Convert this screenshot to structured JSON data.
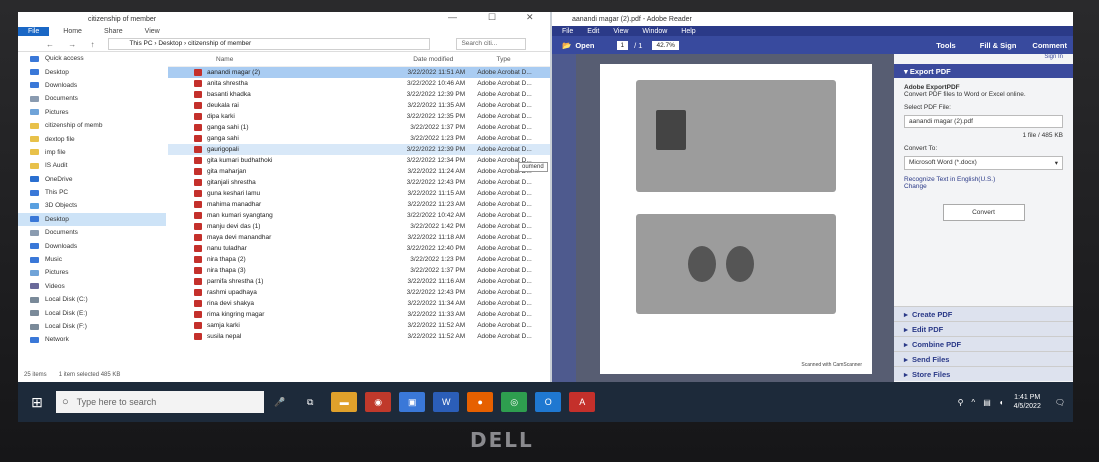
{
  "explorer": {
    "title": "citizenship of member",
    "ribbon": [
      "File",
      "Home",
      "Share",
      "View"
    ],
    "nav_glyphs": "← → ↑",
    "path": "This PC › Desktop › citizenship of member",
    "search_placeholder": "Search citi...",
    "nav_items": [
      {
        "label": "Quick access",
        "color": "#3a78d8"
      },
      {
        "label": "Desktop",
        "color": "#3a78d8"
      },
      {
        "label": "Downloads",
        "color": "#3a78d8"
      },
      {
        "label": "Documents",
        "color": "#8a9bb0"
      },
      {
        "label": "Pictures",
        "color": "#6fa3d8"
      },
      {
        "label": "citizenship of memb",
        "color": "#e8c14a"
      },
      {
        "label": "dextop file",
        "color": "#e8c14a"
      },
      {
        "label": "imp file",
        "color": "#e8c14a"
      },
      {
        "label": "IS Audit",
        "color": "#e8c14a"
      },
      {
        "label": "OneDrive",
        "color": "#2a6fd0"
      },
      {
        "label": "This PC",
        "color": "#3a78d8"
      },
      {
        "label": "3D Objects",
        "color": "#5aa0e0"
      },
      {
        "label": "Desktop",
        "color": "#3a78d8",
        "selected": true
      },
      {
        "label": "Documents",
        "color": "#8a9bb0"
      },
      {
        "label": "Downloads",
        "color": "#3a78d8"
      },
      {
        "label": "Music",
        "color": "#3a78d8"
      },
      {
        "label": "Pictures",
        "color": "#6fa3d8"
      },
      {
        "label": "Videos",
        "color": "#6a6a9a"
      },
      {
        "label": "Local Disk (C:)",
        "color": "#7a8a99"
      },
      {
        "label": "Local Disk (E:)",
        "color": "#7a8a99"
      },
      {
        "label": "Local Disk (F:)",
        "color": "#7a8a99"
      },
      {
        "label": "Network",
        "color": "#3a78d8"
      }
    ],
    "columns": {
      "name": "Name",
      "date": "Date modified",
      "type": "Type"
    },
    "files": [
      {
        "name": "aanandi magar (2)",
        "date": "3/22/2022 11:51 AM",
        "type": "Adobe Acrobat D...",
        "state": "selected"
      },
      {
        "name": "anita shrestha",
        "date": "3/22/2022 10:46 AM",
        "type": "Adobe Acrobat D..."
      },
      {
        "name": "basanti khadka",
        "date": "3/22/2022 12:39 PM",
        "type": "Adobe Acrobat D..."
      },
      {
        "name": "deukala rai",
        "date": "3/22/2022 11:35 AM",
        "type": "Adobe Acrobat D..."
      },
      {
        "name": "dipa karki",
        "date": "3/22/2022 12:35 PM",
        "type": "Adobe Acrobat D..."
      },
      {
        "name": "ganga sahi (1)",
        "date": "3/22/2022 1:37 PM",
        "type": "Adobe Acrobat D..."
      },
      {
        "name": "ganga sahi",
        "date": "3/22/2022 1:23 PM",
        "type": "Adobe Acrobat D..."
      },
      {
        "name": "gaurigopali",
        "date": "3/22/2022 12:39 PM",
        "type": "Adobe Acrobat D...",
        "state": "hover"
      },
      {
        "name": "gita kumari budhathoki",
        "date": "3/22/2022 12:34 PM",
        "type": "Adobe Acrobat D..."
      },
      {
        "name": "gita maharjan",
        "date": "3/22/2022 11:24 AM",
        "type": "Adobe Acrobat D..."
      },
      {
        "name": "gitanjali shrestha",
        "date": "3/22/2022 12:43 PM",
        "type": "Adobe Acrobat D..."
      },
      {
        "name": "guna keshari lamu",
        "date": "3/22/2022 11:15 AM",
        "type": "Adobe Acrobat D..."
      },
      {
        "name": "mahima manadhar",
        "date": "3/22/2022 11:23 AM",
        "type": "Adobe Acrobat D..."
      },
      {
        "name": "man kumari syangtang",
        "date": "3/22/2022 10:42 AM",
        "type": "Adobe Acrobat D..."
      },
      {
        "name": "manju devi das (1)",
        "date": "3/22/2022 1:42 PM",
        "type": "Adobe Acrobat D..."
      },
      {
        "name": "maya devi manandhar",
        "date": "3/22/2022 11:18 AM",
        "type": "Adobe Acrobat D..."
      },
      {
        "name": "nanu tuladhar",
        "date": "3/22/2022 12:40 PM",
        "type": "Adobe Acrobat D..."
      },
      {
        "name": "nira thapa (2)",
        "date": "3/22/2022 1:23 PM",
        "type": "Adobe Acrobat D..."
      },
      {
        "name": "nira thapa (3)",
        "date": "3/22/2022 1:37 PM",
        "type": "Adobe Acrobat D..."
      },
      {
        "name": "parnifa shrestha (1)",
        "date": "3/22/2022 11:16 AM",
        "type": "Adobe Acrobat D..."
      },
      {
        "name": "rashmi upadhaya",
        "date": "3/22/2022 12:43 PM",
        "type": "Adobe Acrobat D..."
      },
      {
        "name": "rina devi shakya",
        "date": "3/22/2022 11:34 AM",
        "type": "Adobe Acrobat D..."
      },
      {
        "name": "rima kingring magar",
        "date": "3/22/2022 11:33 AM",
        "type": "Adobe Acrobat D..."
      },
      {
        "name": "samja karki",
        "date": "3/22/2022 11:52 AM",
        "type": "Adobe Acrobat D..."
      },
      {
        "name": "susila nepal",
        "date": "3/22/2022 11:52 AM",
        "type": "Adobe Acrobat D..."
      }
    ],
    "tooltip": "oumend",
    "status_items": "25 items",
    "status_selected": "1 item selected 485 KB"
  },
  "reader": {
    "title": "aanandi magar (2).pdf - Adobe Reader",
    "menu": [
      "File",
      "Edit",
      "View",
      "Window",
      "Help"
    ],
    "open_label": "Open",
    "page_current": "1",
    "page_total": "/ 1",
    "zoom": "42.7%",
    "tabs": [
      "Tools",
      "Fill & Sign",
      "Comment"
    ],
    "sign_in": "Sign In",
    "panel": {
      "export_header": "Export PDF",
      "heading": "Adobe ExportPDF",
      "description": "Convert PDF files to Word or Excel online.",
      "select_label": "Select PDF File:",
      "file_name": "aanandi magar (2).pdf",
      "file_info": "1 file / 485 KB",
      "convert_to_label": "Convert To:",
      "convert_to_value": "Microsoft Word (*.docx)",
      "recognize": "Recognize Text in English(U.S.)",
      "change": "Change",
      "convert_button": "Convert",
      "sections": [
        "Create PDF",
        "Edit PDF",
        "Combine PDF",
        "Send Files",
        "Store Files"
      ]
    },
    "scan_note": "Scanned with CamScanner",
    "colors": {
      "toolbar": "#384a9e",
      "doc_bg": "#575d72"
    }
  },
  "taskbar": {
    "search_placeholder": "Type here to search",
    "apps": [
      {
        "name": "task-view",
        "color": "#1d2a3a",
        "glyph": "⧉"
      },
      {
        "name": "file-explorer",
        "color": "#e0a12b",
        "glyph": "▬"
      },
      {
        "name": "photos",
        "color": "#c0392b",
        "glyph": "◉"
      },
      {
        "name": "store",
        "color": "#3a78d8",
        "glyph": "▣"
      },
      {
        "name": "word",
        "color": "#2b5eb8",
        "glyph": "W"
      },
      {
        "name": "firefox",
        "color": "#e66000",
        "glyph": "●"
      },
      {
        "name": "chrome",
        "color": "#2e9e4f",
        "glyph": "◎"
      },
      {
        "name": "outlook",
        "color": "#1f78d1",
        "glyph": "O"
      },
      {
        "name": "adobe-reader",
        "color": "#c4302b",
        "glyph": "A"
      }
    ],
    "time": "1:41 PM",
    "date": "4/5/2022"
  },
  "laptop_brand": "DELL"
}
